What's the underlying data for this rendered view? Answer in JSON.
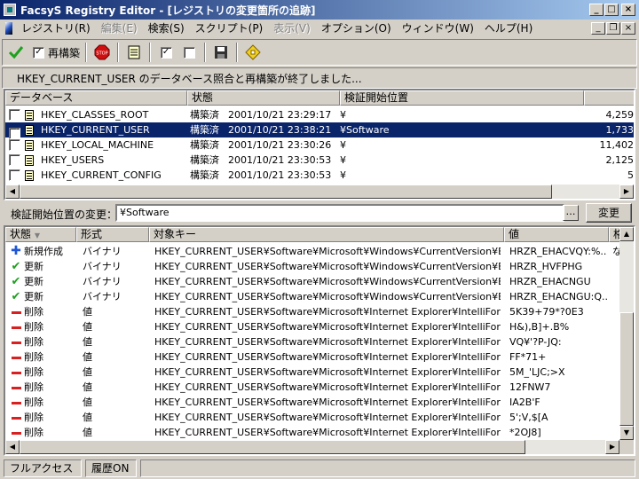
{
  "window": {
    "title": "FacsyS Registry Editor - [レジストリの変更箇所の追跡]"
  },
  "menu": [
    "レジストリ(R)",
    "編集(E)",
    "検索(S)",
    "スクリプト(P)",
    "表示(V)",
    "オプション(O)",
    "ウィンドウ(W)",
    "ヘルプ(H)"
  ],
  "menu_disabled": [
    false,
    true,
    false,
    false,
    true,
    false,
    false,
    false
  ],
  "toolbar": {
    "rebuild_label": "再構築",
    "rebuild_checked": true
  },
  "message": "HKEY_CURRENT_USER のデータベース照合と再構築が終了しました...",
  "db_list": {
    "headers": [
      "データベース",
      "状態",
      "検証開始位置",
      ""
    ],
    "rows": [
      {
        "name": "HKEY_CLASSES_ROOT",
        "status": "構築済",
        "date": "2001/10/21 23:29:17",
        "start": "¥",
        "count": "4,259",
        "checked": false,
        "selected": false
      },
      {
        "name": "HKEY_CURRENT_USER",
        "status": "構築済",
        "date": "2001/10/21 23:38:21",
        "start": "¥Software",
        "count": "1,733",
        "checked": true,
        "selected": true
      },
      {
        "name": "HKEY_LOCAL_MACHINE",
        "status": "構築済",
        "date": "2001/10/21 23:30:26",
        "start": "¥",
        "count": "11,402",
        "checked": false,
        "selected": false
      },
      {
        "name": "HKEY_USERS",
        "status": "構築済",
        "date": "2001/10/21 23:30:53",
        "start": "¥",
        "count": "2,125",
        "checked": false,
        "selected": false
      },
      {
        "name": "HKEY_CURRENT_CONFIG",
        "status": "構築済",
        "date": "2001/10/21 23:30:53",
        "start": "¥",
        "count": "5",
        "checked": false,
        "selected": false
      }
    ]
  },
  "filter": {
    "label": "検証開始位置の変更：",
    "value": "¥Software",
    "browse_label": "…",
    "change_label": "変更"
  },
  "changes": {
    "headers": [
      "状態",
      "形式",
      "対象キー",
      "値",
      "格"
    ],
    "rows": [
      {
        "icon": "plus",
        "status": "新規作成",
        "type": "バイナリ",
        "key": "HKEY_CURRENT_USER¥Software¥Microsoft¥Windows¥CurrentVersion¥Ex...",
        "value": "HRZR_EHACVQY:%...",
        "extra": "な"
      },
      {
        "icon": "tick",
        "status": "更新",
        "type": "バイナリ",
        "key": "HKEY_CURRENT_USER¥Software¥Microsoft¥Windows¥CurrentVersion¥Ex...",
        "value": "HRZR_HVFPHG",
        "extra": ""
      },
      {
        "icon": "tick",
        "status": "更新",
        "type": "バイナリ",
        "key": "HKEY_CURRENT_USER¥Software¥Microsoft¥Windows¥CurrentVersion¥Ex...",
        "value": "HRZR_EHACNGU",
        "extra": ""
      },
      {
        "icon": "tick",
        "status": "更新",
        "type": "バイナリ",
        "key": "HKEY_CURRENT_USER¥Software¥Microsoft¥Windows¥CurrentVersion¥Ex...",
        "value": "HRZR_EHACNGU:Q...",
        "extra": ""
      },
      {
        "icon": "minus",
        "status": "削除",
        "type": "値",
        "key": "HKEY_CURRENT_USER¥Software¥Microsoft¥Internet Explorer¥IntelliForm...",
        "value": "5K39+79*?0E3",
        "extra": ""
      },
      {
        "icon": "minus",
        "status": "削除",
        "type": "値",
        "key": "HKEY_CURRENT_USER¥Software¥Microsoft¥Internet Explorer¥IntelliForm...",
        "value": "H&),B]+.B%",
        "extra": ""
      },
      {
        "icon": "minus",
        "status": "削除",
        "type": "値",
        "key": "HKEY_CURRENT_USER¥Software¥Microsoft¥Internet Explorer¥IntelliForm...",
        "value": "VQ¥'?P-JQ:",
        "extra": ""
      },
      {
        "icon": "minus",
        "status": "削除",
        "type": "値",
        "key": "HKEY_CURRENT_USER¥Software¥Microsoft¥Internet Explorer¥IntelliForm...",
        "value": "FF*71+",
        "extra": ""
      },
      {
        "icon": "minus",
        "status": "削除",
        "type": "値",
        "key": "HKEY_CURRENT_USER¥Software¥Microsoft¥Internet Explorer¥IntelliForm...",
        "value": "5M_'LJC;>X",
        "extra": ""
      },
      {
        "icon": "minus",
        "status": "削除",
        "type": "値",
        "key": "HKEY_CURRENT_USER¥Software¥Microsoft¥Internet Explorer¥IntelliForm...",
        "value": "12FNW7",
        "extra": ""
      },
      {
        "icon": "minus",
        "status": "削除",
        "type": "値",
        "key": "HKEY_CURRENT_USER¥Software¥Microsoft¥Internet Explorer¥IntelliForm...",
        "value": "IA2B'F",
        "extra": ""
      },
      {
        "icon": "minus",
        "status": "削除",
        "type": "値",
        "key": "HKEY_CURRENT_USER¥Software¥Microsoft¥Internet Explorer¥IntelliForm...",
        "value": "5';V,$[A",
        "extra": ""
      },
      {
        "icon": "minus",
        "status": "削除",
        "type": "値",
        "key": "HKEY_CURRENT_USER¥Software¥Microsoft¥Internet Explorer¥IntelliForm...",
        "value": "*2OJ8]",
        "extra": ""
      }
    ]
  },
  "statusbar": {
    "access": "フルアクセス",
    "history": "履歴ON"
  },
  "colors": {
    "selection": "#0a246a",
    "face": "#d4d0c8",
    "tick": "#20a020",
    "minus": "#d82020",
    "plus": "#1f56d6"
  },
  "icons": [
    "app-icon",
    "registry-icon",
    "check-icon",
    "stop-icon",
    "notes-icon",
    "checkbox-icon",
    "save-icon",
    "diamond-icon"
  ]
}
